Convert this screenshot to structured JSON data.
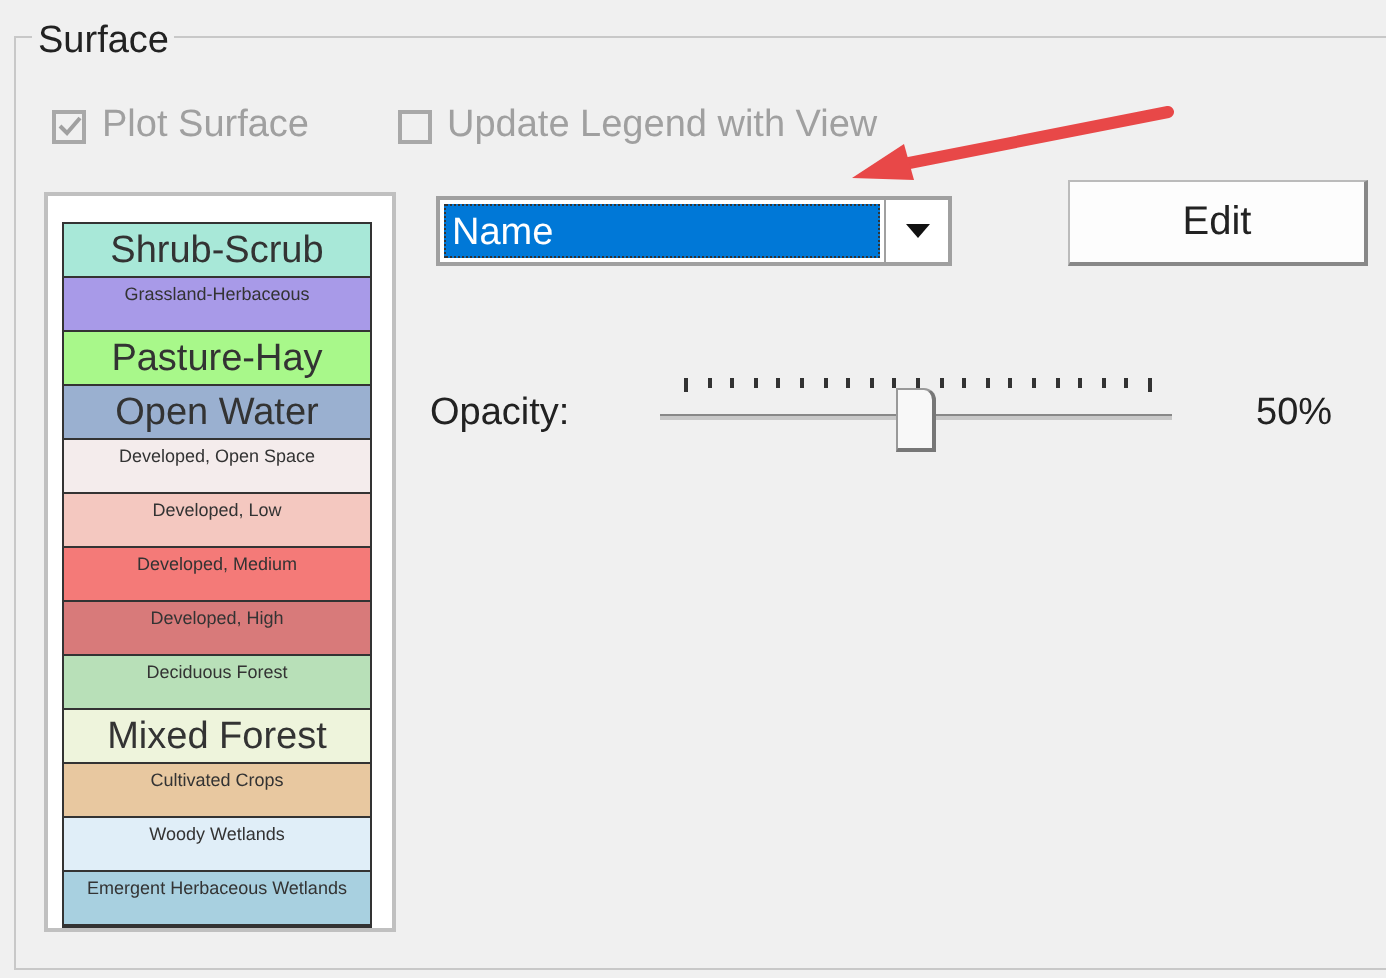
{
  "group": {
    "title": "Surface"
  },
  "checkboxes": [
    {
      "label": "Plot Surface",
      "checked": true,
      "disabled": true
    },
    {
      "label": "Update Legend with View",
      "checked": false,
      "disabled": true
    }
  ],
  "legend": [
    {
      "label": "Shrub-Scrub",
      "color": "#a8e8d8",
      "kind": "large"
    },
    {
      "label": "Grassland-Herbaceous",
      "color": "#a89ae8",
      "kind": "small"
    },
    {
      "label": "Pasture-Hay",
      "color": "#a8f88a",
      "kind": "large"
    },
    {
      "label": "Open Water",
      "color": "#9ab0d0",
      "kind": "large"
    },
    {
      "label": "Developed, Open Space",
      "color": "#f4ecec",
      "kind": "small"
    },
    {
      "label": "Developed, Low",
      "color": "#f4c8c0",
      "kind": "small"
    },
    {
      "label": "Developed, Medium",
      "color": "#f47a78",
      "kind": "small"
    },
    {
      "label": "Developed, High",
      "color": "#d87a7a",
      "kind": "small"
    },
    {
      "label": "Deciduous Forest",
      "color": "#b8e0b8",
      "kind": "small"
    },
    {
      "label": "Mixed Forest",
      "color": "#eef4dc",
      "kind": "large"
    },
    {
      "label": "Cultivated Crops",
      "color": "#e8c8a0",
      "kind": "small"
    },
    {
      "label": "Woody Wetlands",
      "color": "#e0eef8",
      "kind": "small"
    },
    {
      "label": "Emergent Herbaceous Wetlands",
      "color": "#a8d0e0",
      "kind": "small"
    }
  ],
  "dropdown": {
    "value": "Name"
  },
  "edit_button": "Edit",
  "opacity": {
    "label": "Opacity:",
    "level": 0.5,
    "reading": "50%"
  }
}
